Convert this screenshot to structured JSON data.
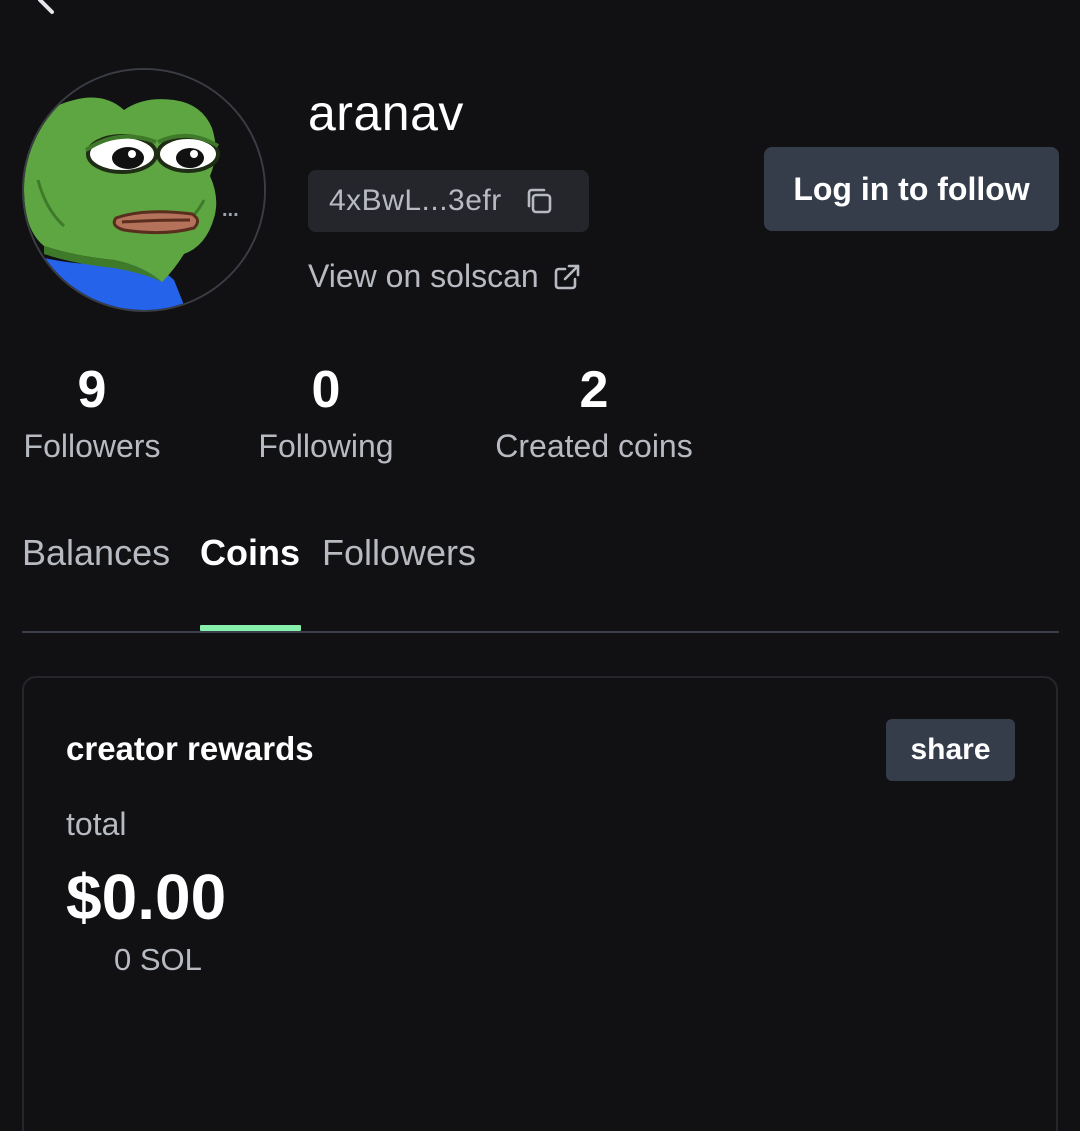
{
  "profile": {
    "username": "aranav",
    "address": "4xBwL...3efr",
    "solscan_label": "View on solscan",
    "avatar_ellipsis": "...",
    "follow_label": "Log in to follow"
  },
  "stats": [
    {
      "value": "9",
      "label": "Followers"
    },
    {
      "value": "0",
      "label": "Following"
    },
    {
      "value": "2",
      "label": "Created coins"
    }
  ],
  "tabs": [
    {
      "label": "Balances",
      "active": false
    },
    {
      "label": "Coins",
      "active": true
    },
    {
      "label": "Followers",
      "active": false
    }
  ],
  "rewards": {
    "title": "creator rewards",
    "share_label": "share",
    "total_label": "total",
    "total_usd": "$0.00",
    "total_sol": "0 SOL"
  },
  "colors": {
    "background": "#111114",
    "button": "#353d4b",
    "tab_accent": "#86efac",
    "muted_text": "#b7bac1"
  },
  "icons": [
    "chevron-left-icon",
    "copy-icon",
    "external-link-icon"
  ]
}
